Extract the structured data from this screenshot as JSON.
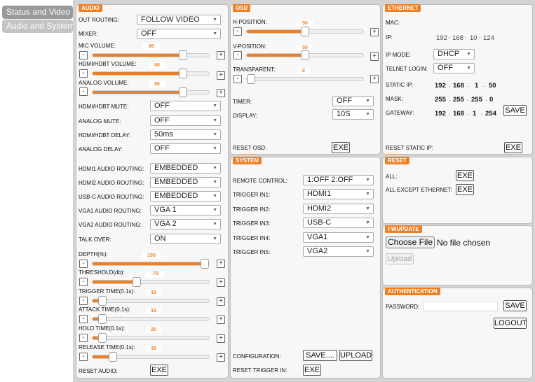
{
  "tabs": [
    {
      "label": "Status and Video",
      "active": true
    },
    {
      "label": "Audio and System",
      "active": false
    }
  ],
  "colors": {
    "accent": "#ef7f22",
    "background": "#d3d3d3",
    "panel": "#f7f7f7"
  },
  "audio": {
    "title": "AUDIO",
    "out_routing": {
      "label": "OUT ROUTING:",
      "value": "FOLLOW VIDEO"
    },
    "mixer": {
      "label": "MIXER:",
      "value": "OFF"
    },
    "mic_volume": {
      "label": "MIC VOLUME:",
      "value": "80",
      "level": 80
    },
    "hdmi_volume": {
      "label": "HDMI/HDBT VOLUME:",
      "value": "80",
      "level": 80
    },
    "analog_volume": {
      "label": "ANALOG VOLUME:",
      "value": "80",
      "level": 80
    },
    "hdmi_mute": {
      "label": "HDMI/HDBT MUTE:",
      "value": "OFF"
    },
    "analog_mute": {
      "label": "ANALOG MUTE:",
      "value": "OFF"
    },
    "hdmi_delay": {
      "label": "HDMI/HDBT DELAY:",
      "value": "50ms"
    },
    "analog_delay": {
      "label": "ANALOG DELAY:",
      "value": "OFF"
    },
    "hdmi1_routing": {
      "label": "HDMI1 AUDIO ROUTING:",
      "value": "EMBEDDED"
    },
    "hdmi2_routing": {
      "label": "HDMI2 AUDIO ROUTING:",
      "value": "EMBEDDED"
    },
    "usbc_routing": {
      "label": "USB-C AUDIO ROUTING:",
      "value": "EMBEDDED"
    },
    "vga1_routing": {
      "label": "VGA1 AUDIO ROUTING:",
      "value": "VGA 1"
    },
    "vga2_routing": {
      "label": "VGA2 AUDIO ROUTING:",
      "value": "VGA 2"
    },
    "talk_over": {
      "label": "TALK OVER:",
      "value": "ON"
    },
    "depth": {
      "label": "DEPTH(%):",
      "value": "100",
      "level": 100
    },
    "threshold": {
      "label": "THRESHOLD(db):",
      "value": "-70",
      "level": 37
    },
    "trigger_time": {
      "label": "TRIGGER TIME(0.1s):",
      "value": "10",
      "level": 5
    },
    "attack_time": {
      "label": "ATTACK TIME(0.1s):",
      "value": "10",
      "level": 5
    },
    "hold_time": {
      "label": "HOLD TIME(0.1s):",
      "value": "20",
      "level": 5
    },
    "release_time": {
      "label": "RELEASE TIME(0.1s):",
      "value": "30",
      "level": 15
    },
    "reset": {
      "label": "RESET AUDIO:",
      "button": "EXE"
    }
  },
  "osd": {
    "title": "OSD",
    "h_position": {
      "label": "H-POSITION:",
      "value": "50",
      "level": 50
    },
    "v_position": {
      "label": "V-POSITION:",
      "value": "50",
      "level": 50
    },
    "transparent": {
      "label": "TRANSPARENT:",
      "value": "0",
      "level": 0
    },
    "timer": {
      "label": "TIMER:",
      "value": "OFF"
    },
    "display": {
      "label": "DISPLAY:",
      "value": "10S"
    },
    "reset": {
      "label": "RESET OSD:",
      "button": "EXE"
    }
  },
  "system": {
    "title": "SYSTEM",
    "remote_control": {
      "label": "REMOTE CONTROL:",
      "value": "1:OFF 2:OFF"
    },
    "trigger_in1": {
      "label": "TRIGGER IN1:",
      "value": "HDMI1"
    },
    "trigger_in2": {
      "label": "TRIGGER IN2:",
      "value": "HDMI2"
    },
    "trigger_in3": {
      "label": "TRIGGER IN3:",
      "value": "USB-C"
    },
    "trigger_in4": {
      "label": "TRIGGER IN4:",
      "value": "VGA1"
    },
    "trigger_in5": {
      "label": "TRIGGER IN5:",
      "value": "VGA2"
    },
    "configuration": {
      "label": "CONFIGURATION:",
      "save": "SAVE....",
      "upload": "UPLOAD"
    },
    "reset_trigger": {
      "label": "RESET TRIGGER IN:",
      "button": "EXE"
    }
  },
  "ethernet": {
    "title": "ETHERNET",
    "mac_label": "MAC:",
    "ip_label": "IP:",
    "ip": [
      "192",
      "168",
      "10",
      "124"
    ],
    "ip_mode": {
      "label": "IP MODE:",
      "value": "DHCP"
    },
    "telnet": {
      "label": "TELNET LOGIN:",
      "value": "OFF"
    },
    "static_ip": {
      "label": "STATIC IP:",
      "octets": [
        "192",
        "168",
        "1",
        "50"
      ]
    },
    "mask": {
      "label": "MASK:",
      "octets": [
        "255",
        "255",
        "255",
        "0"
      ]
    },
    "gateway": {
      "label": "GATEWAY:",
      "octets": [
        "192",
        "168",
        "1",
        "254"
      ]
    },
    "save": "SAVE",
    "reset": {
      "label": "RESET STATIC IP:",
      "button": "EXE"
    }
  },
  "reset": {
    "title": "RESET",
    "all": {
      "label": "ALL:",
      "button": "EXE"
    },
    "all_except": {
      "label": "ALL EXCEPT ETHERNET:",
      "button": "EXE"
    }
  },
  "fwupdate": {
    "title": "FWUPDATE",
    "choose": "Choose File",
    "no_file": "No file chosen",
    "upload": "Upload"
  },
  "auth": {
    "title": "AUTHENTICATION",
    "password_label": "PASSWORD:",
    "save": "SAVE",
    "logout": "LOGOUT"
  }
}
